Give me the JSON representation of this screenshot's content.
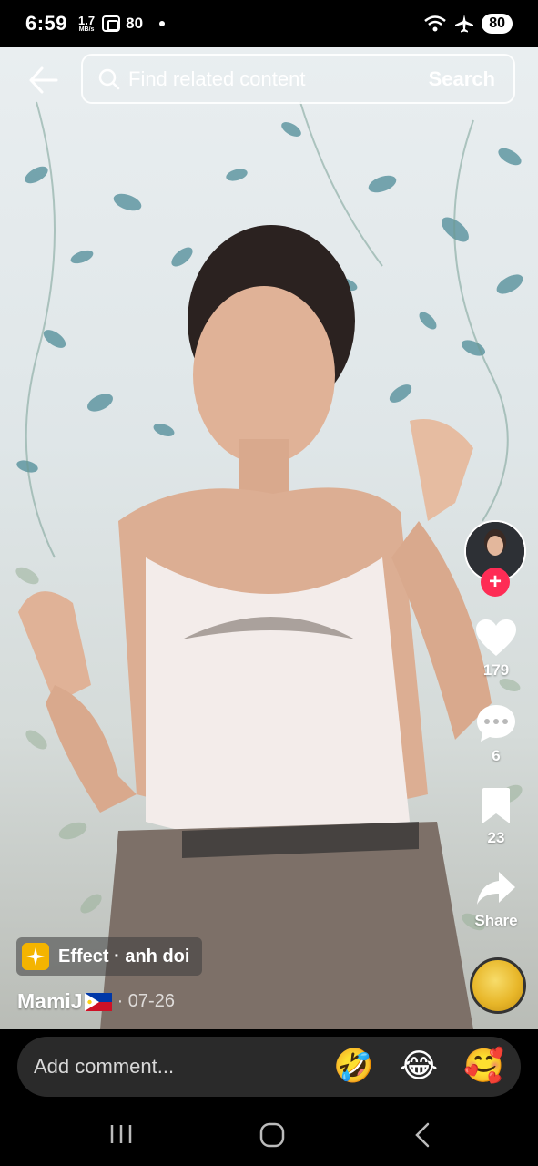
{
  "status_bar": {
    "time": "6:59",
    "net_speed_value": "1.7",
    "net_speed_unit": "MB/s",
    "notif_count": "80",
    "battery": "80"
  },
  "search": {
    "placeholder": "Find related content",
    "button_label": "Search"
  },
  "actions": {
    "likes": "179",
    "comments": "6",
    "saves": "23",
    "share_label": "Share",
    "follow_symbol": "+"
  },
  "video_info": {
    "effect_label": "Effect · anh doi",
    "author": "MamiJ",
    "date": "· 07-26"
  },
  "comment_bar": {
    "placeholder": "Add comment...",
    "emojis": [
      "🤣",
      "😂",
      "🥰"
    ]
  },
  "colors": {
    "accent": "#fe2c55",
    "effect_icon": "#f4b400"
  },
  "icons": [
    "back-arrow-icon",
    "search-icon",
    "heart-icon",
    "comment-icon",
    "bookmark-icon",
    "share-icon",
    "wifi-icon",
    "airplane-icon"
  ]
}
